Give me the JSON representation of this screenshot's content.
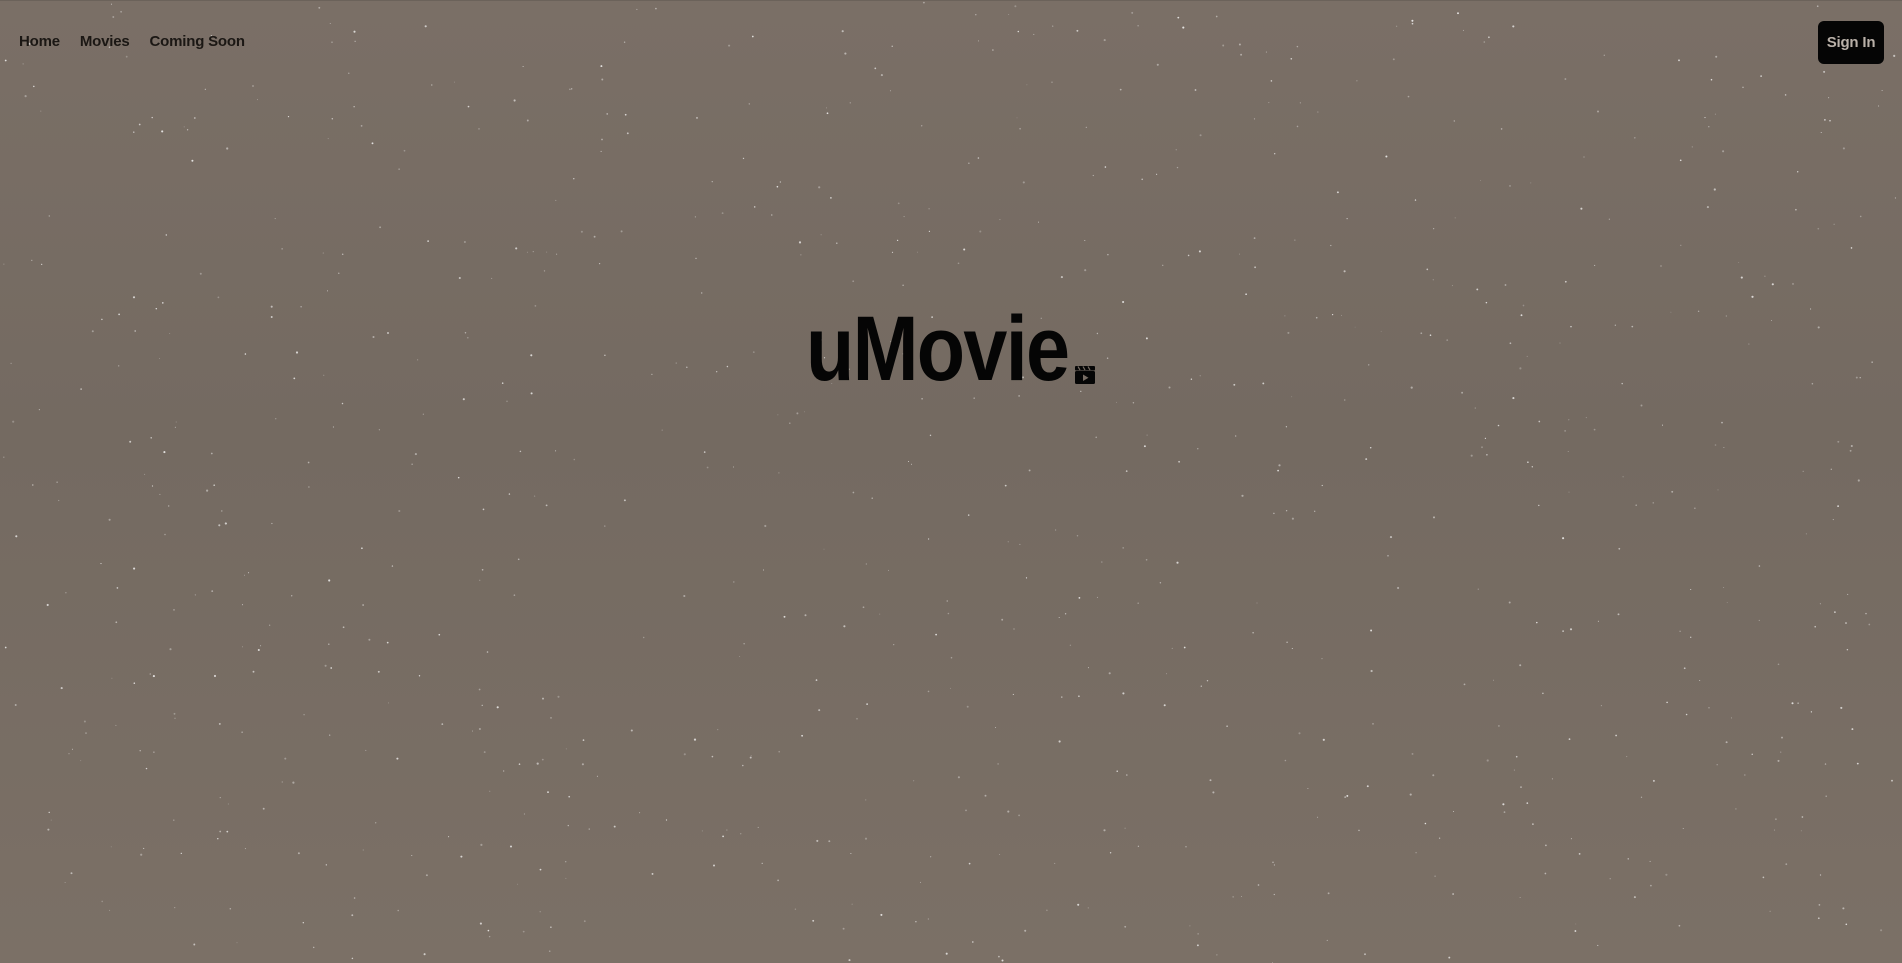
{
  "nav": {
    "items": [
      {
        "label": "Home"
      },
      {
        "label": "Movies"
      },
      {
        "label": "Coming Soon"
      }
    ]
  },
  "header": {
    "signin_label": "Sign In"
  },
  "hero": {
    "logo_text": "uMovie",
    "logo_icon": "clapperboard-play-icon"
  },
  "colors": {
    "background": "#776c63",
    "text": "#050505",
    "button_bg": "#050505",
    "button_text": "#b9b0a8"
  }
}
